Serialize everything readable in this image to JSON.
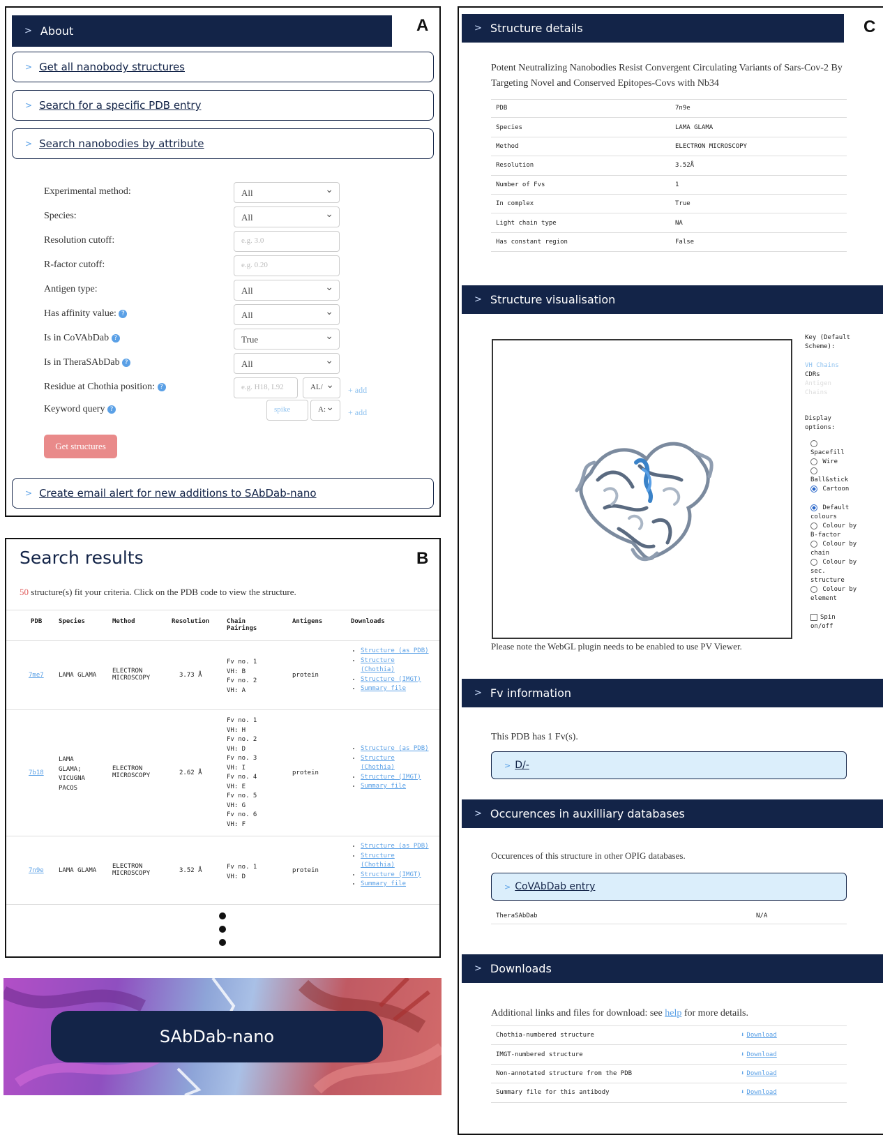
{
  "panelA": {
    "letter": "A",
    "about": "About",
    "accordions": [
      "Get all nanobody structures",
      "Search for a specific PDB entry",
      "Search nanobodies by attribute"
    ],
    "chev": ">",
    "form": {
      "rows": [
        {
          "label": "Experimental method:",
          "value": "All",
          "help": false
        },
        {
          "label": "Species:",
          "value": "All",
          "help": false
        },
        {
          "label": "Resolution cutoff:",
          "placeholder": "e.g. 3.0",
          "help": false
        },
        {
          "label": "R-factor cutoff:",
          "placeholder": "e.g. 0.20",
          "help": false
        },
        {
          "label": "Antigen type:",
          "value": "All",
          "help": false
        },
        {
          "label": "Has affinity value:",
          "value": "All",
          "help": true
        },
        {
          "label": "Is in CoVAbDab",
          "value": "True",
          "help": true
        },
        {
          "label": "Is in TheraSAbDab",
          "value": "All",
          "help": true
        }
      ],
      "chothia_label": "Residue at Chothia position:",
      "chothia_placeholder": "e.g. H18, L92",
      "chothia_select": "AL/",
      "keyword_label": "Keyword query",
      "keyword_placeholder": "spike",
      "keyword_select": "A:",
      "add": "+ add",
      "help_glyph": "?",
      "submit": "Get structures"
    },
    "email_alert": "Create email alert for new additions to SAbDab-nano"
  },
  "panelB": {
    "letter": "B",
    "title": "Search results",
    "count": "50",
    "summary": "structure(s) fit your criteria. Click on the PDB code to view the structure.",
    "headers": [
      "PDB",
      "Species",
      "Method",
      "Resolution",
      "Chain Pairings",
      "Antigens",
      "Downloads"
    ],
    "rows": [
      {
        "pdb": "7me7",
        "species": "LAMA GLAMA",
        "method": "ELECTRON MICROSCOPY",
        "resolution": "3.73 Å",
        "pairings": [
          "Fv no. 1",
          "VH: B",
          "Fv no. 2",
          "VH: A"
        ],
        "antigens": "protein"
      },
      {
        "pdb": "7b18",
        "species": "LAMA GLAMA; VICUGNA PACOS",
        "method": "ELECTRON MICROSCOPY",
        "resolution": "2.62 Å",
        "pairings": [
          "Fv no. 1",
          "VH: H",
          "Fv no. 2",
          "VH: D",
          "Fv no. 3",
          "VH: I",
          "Fv no. 4",
          "VH: E",
          "Fv no. 5",
          "VH: G",
          "Fv no. 6",
          "VH: F"
        ],
        "antigens": "protein"
      },
      {
        "pdb": "7n9e",
        "species": "LAMA GLAMA",
        "method": "ELECTRON MICROSCOPY",
        "resolution": "3.52 Å",
        "pairings": [
          "Fv no. 1",
          "VH: D"
        ],
        "antigens": "protein"
      }
    ],
    "downloads": [
      "Structure (as PDB)",
      "Structure (Chothia)",
      "Structure (IMGT)",
      "Summary file"
    ]
  },
  "banner": {
    "title": "SAbDab-nano"
  },
  "panelC": {
    "letter": "C",
    "sections": {
      "details": "Structure details",
      "vis": "Structure visualisation",
      "fv": "Fv information",
      "aux": "Occurences in auxilliary databases",
      "downloads": "Downloads"
    },
    "paper_title": "Potent Neutralizing Nanobodies Resist Convergent Circulating Variants of Sars-Cov-2 By Targeting Novel and Conserved Epitopes-Covs with Nb34",
    "details": [
      {
        "k": "PDB",
        "v": "7n9e"
      },
      {
        "k": "Species",
        "v": "LAMA GLAMA"
      },
      {
        "k": "Method",
        "v": "ELECTRON MICROSCOPY"
      },
      {
        "k": "Resolution",
        "v": "3.52Å"
      },
      {
        "k": "Number of Fvs",
        "v": "1"
      },
      {
        "k": "In complex",
        "v": "True"
      },
      {
        "k": "Light chain type",
        "v": "NA"
      },
      {
        "k": "Has constant region",
        "v": "False"
      }
    ],
    "key_title": "Key (Default Scheme):",
    "key_vh": "VH Chains",
    "key_cdrs": "CDRs",
    "key_antigen": "Antigen Chains",
    "display_title": "Display options:",
    "display_opts": [
      {
        "label": "Spacefill",
        "on": false
      },
      {
        "label": "Wire",
        "on": false
      },
      {
        "label": "Ball&stick",
        "on": false
      },
      {
        "label": "Cartoon",
        "on": true
      }
    ],
    "colour_opts": [
      {
        "label": "Default colours",
        "on": true
      },
      {
        "label": "Colour by B-factor",
        "on": false
      },
      {
        "label": "Colour by chain",
        "on": false
      },
      {
        "label": "Colour by sec. structure",
        "on": false
      },
      {
        "label": "Colour by element",
        "on": false
      }
    ],
    "spin": "Spin on/off",
    "webgl_note": "Please note the WebGL plugin needs to be enabled to use PV Viewer.",
    "fv_text": "This PDB has 1 Fv(s).",
    "fv_item": "D/-",
    "aux_text": "Occurences of this structure in other OPIG databases.",
    "aux_item": "CoVAbDab entry",
    "thera_label": "TheraSAbDab",
    "thera_value": "N/A",
    "dl_text_pre": "Additional links and files for download: see",
    "dl_help": "help",
    "dl_text_post": "for more details.",
    "dl_rows": [
      "Chothia-numbered structure",
      "IMGT-numbered structure",
      "Non-annotated structure from the PDB",
      "Summary file for this antibody"
    ],
    "dl_link": "Download",
    "dl_icon": "⬇"
  }
}
